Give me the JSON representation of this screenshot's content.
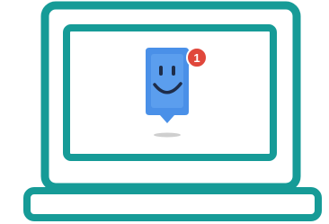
{
  "illustration": {
    "name": "laptop-notification-illustration",
    "notification": {
      "icon": "smiley-chat-bubble-icon",
      "badge_count": "1"
    }
  },
  "colors": {
    "laptop_outline": "#169b97",
    "screen_fill": "#ffffff",
    "bubble_blue": "#4a90e8",
    "bubble_blue_light": "#6aaaf2",
    "smile_dark": "#1e2d4a",
    "badge_red": "#e0473b",
    "shadow": "#cfcfcf"
  }
}
